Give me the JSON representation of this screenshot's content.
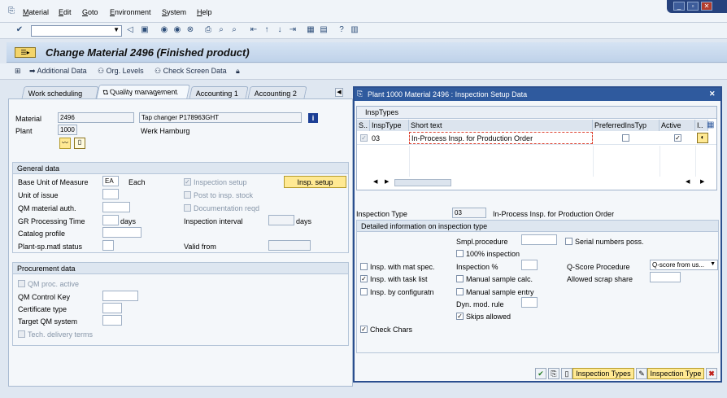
{
  "menu": {
    "items": [
      "Material",
      "Edit",
      "Goto",
      "Environment",
      "System",
      "Help"
    ]
  },
  "window_controls": {
    "minimize": "_",
    "maximize": "▫",
    "close": "✕"
  },
  "title": "Change Material 2496 (Finished product)",
  "app_toolbar": {
    "additional_data": "Additional Data",
    "org_levels": "Org. Levels",
    "check_screen_data": "Check Screen Data"
  },
  "tabs": [
    "Work scheduling",
    "Quality management",
    "Accounting 1",
    "Accounting 2"
  ],
  "header": {
    "material_label": "Material",
    "material_value": "2496",
    "material_desc": "Tap changer P178963GHT",
    "plant_label": "Plant",
    "plant_value": "1000",
    "plant_name": "Werk Hamburg"
  },
  "general": {
    "title": "General data",
    "base_uom_label": "Base Unit of Measure",
    "base_uom_value": "EA",
    "base_uom_text": "Each",
    "unit_issue_label": "Unit of issue",
    "qm_auth_label": "QM material auth.",
    "gr_time_label": "GR Processing Time",
    "gr_time_unit": "days",
    "catalog_label": "Catalog profile",
    "plant_status_label": "Plant-sp.matl status",
    "insp_setup_chk": "Inspection setup",
    "post_insp_chk": "Post to insp. stock",
    "doc_reqd_chk": "Documentation reqd",
    "insp_interval_label": "Inspection interval",
    "insp_interval_unit": "days",
    "valid_from_label": "Valid from",
    "insp_setup_btn": "Insp. setup"
  },
  "procurement": {
    "title": "Procurement data",
    "qm_proc_active": "QM proc. active",
    "qm_control_key": "QM Control Key",
    "certificate_type": "Certificate type",
    "target_qm_system": "Target QM system",
    "tech_delivery": "Tech. delivery terms"
  },
  "popup": {
    "title": "Plant 1000 Material 2496 : Inspection Setup Data",
    "table_title": "InspTypes",
    "columns": [
      "S..",
      "InspType",
      "Short text",
      "PreferredInsTyp",
      "Active",
      "I.."
    ],
    "row": {
      "insp_type": "03",
      "short_text": "In-Process Insp. for Production Order"
    },
    "insp_type_label": "Inspection Type",
    "insp_type_value": "03",
    "insp_type_text": "In-Process Insp. for Production Order",
    "detail_title": "Detailed information on inspection type",
    "smpl_procedure": "Smpl.procedure",
    "serial_numbers": "Serial numbers poss.",
    "hundred_pct": "100% inspection",
    "insp_mat_spec": "Insp. with mat spec.",
    "insp_pct": "Inspection %",
    "qscore_label": "Q-Score Procedure",
    "qscore_value": "Q-score from us...",
    "insp_task_list": "Insp. with task list",
    "manual_sample_calc": "Manual sample calc.",
    "allowed_scrap": "Allowed scrap share",
    "insp_config": "Insp. by configuratn",
    "manual_sample_entry": "Manual sample entry",
    "dyn_mod_rule": "Dyn. mod. rule",
    "skips_allowed": "Skips allowed",
    "check_chars": "Check Chars",
    "btn_insp_types": "Inspection Types",
    "btn_insp_type": "Inspection Type"
  },
  "colors": {
    "accent": "#2f5a9e",
    "button": "#ffe993"
  }
}
